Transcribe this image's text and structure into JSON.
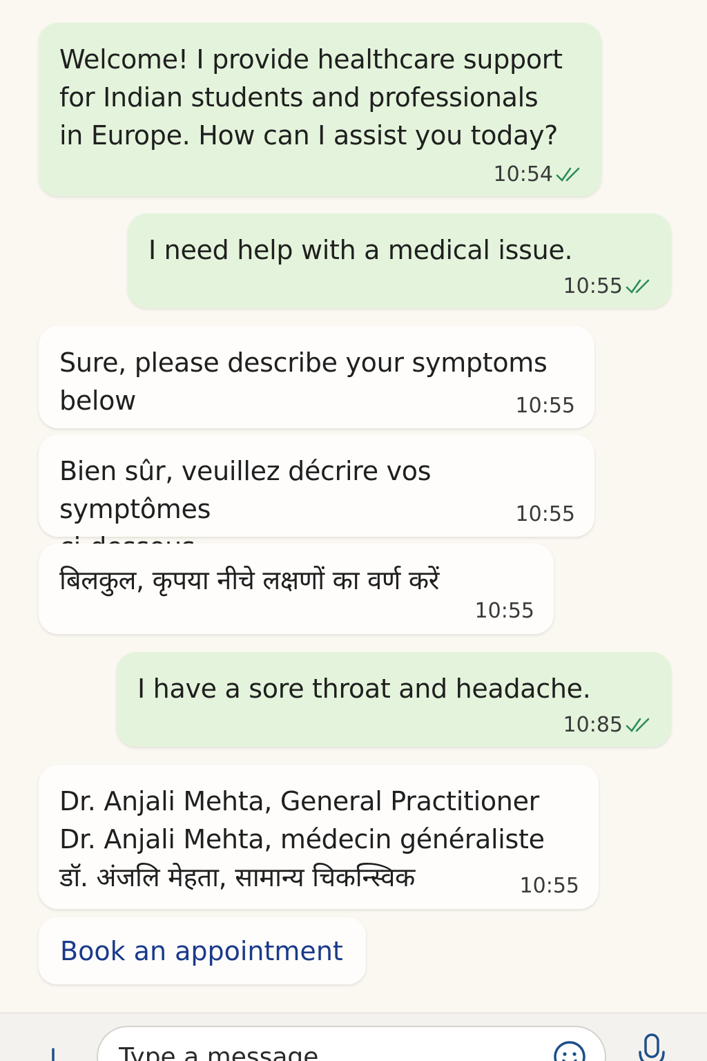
{
  "messages": [
    {
      "text": "Welcome! I provide healthcare support\nfor Indian students and professionals\nin Europe. How can I assist you today?",
      "time": "10:54",
      "direction": "in",
      "read": true
    },
    {
      "text": "I need help with a medical issue.",
      "time": "10:55",
      "direction": "out",
      "read": true
    },
    {
      "text": "Sure, please describe your symptoms\nbelow",
      "time": "10:55",
      "direction": "in",
      "read": false
    },
    {
      "text": "Bien sûr, veuillez décrire vos symptômes\nci-dessous",
      "time": "10:55",
      "direction": "in",
      "read": false
    },
    {
      "text": "बिलकुल, कृपया नीचे लक्षणों का वर्ण करें",
      "time": "10:55",
      "direction": "in",
      "read": false
    },
    {
      "text": "I have a sore throat and headache.",
      "time": "10:85",
      "direction": "out",
      "read": true
    },
    {
      "text": "Dr. Anjali Mehta, General Practitioner\nDr. Anjali Mehta, médecin généraliste\nडॉ. अंजलि मेहता, सामान्य चिकन्स्विक",
      "time": "10:55",
      "direction": "in",
      "read": false
    }
  ],
  "actions": {
    "book_appointment": "Book an appointment"
  },
  "composer": {
    "placeholder": "Type a message"
  },
  "colors": {
    "outgoing_bubble": "#e4f4dc",
    "incoming_bubble": "#fefdfb",
    "read_ticks": "#2e8b57",
    "action_link": "#1a3a8a"
  },
  "icons": {
    "read_receipt": "double-check-icon",
    "attach": "plus-icon",
    "emoji": "emoji-icon",
    "voice": "mic-icon"
  }
}
